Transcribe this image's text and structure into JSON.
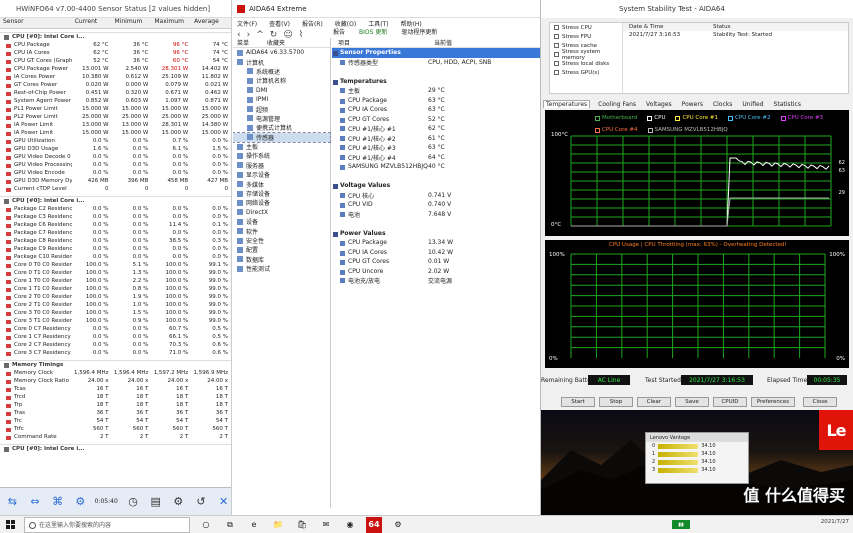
{
  "hwinfo": {
    "title": "HWiNFO64 v7.00-4400 Sensor Status [2 values hidden]",
    "headers": [
      "Sensor",
      "Current",
      "Minimum",
      "Maximum",
      "Average"
    ],
    "groups": [
      {
        "name": "CPU [#0]: Intel Core i...",
        "rows": [
          [
            "CPU Package",
            "62 °C",
            "36 °C",
            "96 °C",
            "74 °C"
          ],
          [
            "CPU IA Cores",
            "62 °C",
            "36 °C",
            "96 °C",
            "74 °C"
          ],
          [
            "CPU GT Cores (Graphics)",
            "52 °C",
            "36 °C",
            "60 °C",
            "54 °C"
          ],
          [
            "CPU Package Power",
            "13.001 W",
            "2.540 W",
            "28.301 W",
            "14.402 W"
          ],
          [
            "IA Cores Power",
            "10.380 W",
            "0.612 W",
            "25.109 W",
            "11.802 W"
          ],
          [
            "GT Cores Power",
            "0.020 W",
            "0.000 W",
            "0.079 W",
            "0.021 W"
          ],
          [
            "Rest-of-Chip Power",
            "0.451 W",
            "0.320 W",
            "0.671 W",
            "0.462 W"
          ],
          [
            "System Agent Power",
            "0.852 W",
            "0.603 W",
            "1.097 W",
            "0.871 W"
          ],
          [
            "PL1 Power Limit",
            "15.000 W",
            "15.000 W",
            "15.000 W",
            "15.000 W"
          ],
          [
            "PL2 Power Limit",
            "25.000 W",
            "25.000 W",
            "25.000 W",
            "25.000 W"
          ],
          [
            "IA Power Limit",
            "13.000 W",
            "13.000 W",
            "28.301 W",
            "14.380 W"
          ],
          [
            "IA Power Limit",
            "15.000 W",
            "15.000 W",
            "15.000 W",
            "15.000 W"
          ],
          [
            "GPU Utilization",
            "0.0 %",
            "0.0 %",
            "0.7 %",
            "0.0 %"
          ],
          [
            "GPU D3D Usage",
            "1.6 %",
            "0.0 %",
            "6.1 %",
            "1.5 %"
          ],
          [
            "GPU Video Decode 0",
            "0.0 %",
            "0.0 %",
            "0.0 %",
            "0.0 %"
          ],
          [
            "GPU Video Processing",
            "0.0 %",
            "0.0 %",
            "0.0 %",
            "0.0 %"
          ],
          [
            "GPU Video Encode",
            "0.0 %",
            "0.0 %",
            "0.0 %",
            "0.0 %"
          ],
          [
            "GPU D3D Memory Dynamic",
            "426 MB",
            "396 MB",
            "458 MB",
            "427 MB"
          ],
          [
            "Current cTDP Level",
            "0",
            "0",
            "0",
            "0"
          ]
        ]
      },
      {
        "name": "CPU [#0]: Intel Core i...",
        "rows": [
          [
            "Package C2 Residency",
            "0.0 %",
            "0.0 %",
            "0.0 %",
            "0.0 %"
          ],
          [
            "Package C3 Residency",
            "0.0 %",
            "0.0 %",
            "0.0 %",
            "0.0 %"
          ],
          [
            "Package C6 Residency",
            "0.0 %",
            "0.0 %",
            "11.4 %",
            "0.1 %"
          ],
          [
            "Package C7 Residency",
            "0.0 %",
            "0.0 %",
            "0.0 %",
            "0.0 %"
          ],
          [
            "Package C8 Residency",
            "0.0 %",
            "0.0 %",
            "38.5 %",
            "0.3 %"
          ],
          [
            "Package C9 Residency",
            "0.0 %",
            "0.0 %",
            "0.0 %",
            "0.0 %"
          ],
          [
            "Package C10 Residency",
            "0.0 %",
            "0.0 %",
            "0.0 %",
            "0.0 %"
          ],
          [
            "Core 0 T0 C0 Residency",
            "100.0 %",
            "5.1 %",
            "100.0 %",
            "99.1 %"
          ],
          [
            "Core 0 T1 C0 Residency",
            "100.0 %",
            "1.3 %",
            "100.0 %",
            "99.0 %"
          ],
          [
            "Core 1 T0 C0 Residency",
            "100.0 %",
            "2.2 %",
            "100.0 %",
            "99.0 %"
          ],
          [
            "Core 1 T1 C0 Residency",
            "100.0 %",
            "0.8 %",
            "100.0 %",
            "99.0 %"
          ],
          [
            "Core 2 T0 C0 Residency",
            "100.0 %",
            "1.9 %",
            "100.0 %",
            "99.0 %"
          ],
          [
            "Core 2 T1 C0 Residency",
            "100.0 %",
            "1.0 %",
            "100.0 %",
            "99.0 %"
          ],
          [
            "Core 3 T0 C0 Residency",
            "100.0 %",
            "1.5 %",
            "100.0 %",
            "99.0 %"
          ],
          [
            "Core 3 T1 C0 Residency",
            "100.0 %",
            "0.9 %",
            "100.0 %",
            "99.0 %"
          ],
          [
            "Core 0 C7 Residency",
            "0.0 %",
            "0.0 %",
            "60.7 %",
            "0.5 %"
          ],
          [
            "Core 1 C7 Residency",
            "0.0 %",
            "0.0 %",
            "66.1 %",
            "0.5 %"
          ],
          [
            "Core 2 C7 Residency",
            "0.0 %",
            "0.0 %",
            "70.3 %",
            "0.6 %"
          ],
          [
            "Core 3 C7 Residency",
            "0.0 %",
            "0.0 %",
            "71.0 %",
            "0.6 %"
          ]
        ]
      },
      {
        "name": "Memory Timings",
        "rows": [
          [
            "Memory Clock",
            "1,596.4 MHz",
            "1,596.4 MHz",
            "1,597.2 MHz",
            "1,596.9 MHz"
          ],
          [
            "Memory Clock Ratio",
            "24.00 x",
            "24.00 x",
            "24.00 x",
            "24.00 x"
          ],
          [
            "Tcas",
            "16 T",
            "16 T",
            "16 T",
            "16 T"
          ],
          [
            "Trcd",
            "18 T",
            "18 T",
            "18 T",
            "18 T"
          ],
          [
            "Trp",
            "18 T",
            "18 T",
            "18 T",
            "18 T"
          ],
          [
            "Tras",
            "36 T",
            "36 T",
            "36 T",
            "36 T"
          ],
          [
            "Trc",
            "54 T",
            "54 T",
            "54 T",
            "54 T"
          ],
          [
            "Trfc",
            "560 T",
            "560 T",
            "560 T",
            "560 T"
          ],
          [
            "Command Rate",
            "2 T",
            "2 T",
            "2 T",
            "2 T"
          ]
        ]
      },
      {
        "name": "CPU [#0]: Intel Core i...",
        "rows": []
      }
    ],
    "toolbar_time": "0:05:40"
  },
  "aida": {
    "title": "AIDA64 Extreme",
    "menu": [
      "文件(F)",
      "查看(V)",
      "报告(R)",
      "收藏(O)",
      "工具(T)",
      "帮助(H)"
    ],
    "toolbar": [
      "报告",
      "BIOS 更新",
      "驱动程序更新"
    ],
    "tree_headers": [
      "菜单",
      "收藏夹"
    ],
    "tree": [
      {
        "label": "AIDA64 v6.33.5700",
        "lvl": 0,
        "sel": false
      },
      {
        "label": "计算机",
        "lvl": 0,
        "sel": false
      },
      {
        "label": "系统概述",
        "lvl": 1,
        "sel": false
      },
      {
        "label": "计算机名称",
        "lvl": 1,
        "sel": false
      },
      {
        "label": "DMI",
        "lvl": 1,
        "sel": false
      },
      {
        "label": "IPMI",
        "lvl": 1,
        "sel": false
      },
      {
        "label": "超频",
        "lvl": 1,
        "sel": false
      },
      {
        "label": "电源管理",
        "lvl": 1,
        "sel": false
      },
      {
        "label": "便携式计算机",
        "lvl": 1,
        "sel": false
      },
      {
        "label": "传感器",
        "lvl": 1,
        "sel": true
      },
      {
        "label": "主板",
        "lvl": 0,
        "sel": false
      },
      {
        "label": "操作系统",
        "lvl": 0,
        "sel": false
      },
      {
        "label": "服务器",
        "lvl": 0,
        "sel": false
      },
      {
        "label": "显示设备",
        "lvl": 0,
        "sel": false
      },
      {
        "label": "多媒体",
        "lvl": 0,
        "sel": false
      },
      {
        "label": "存储设备",
        "lvl": 0,
        "sel": false
      },
      {
        "label": "网络设备",
        "lvl": 0,
        "sel": false
      },
      {
        "label": "DirectX",
        "lvl": 0,
        "sel": false
      },
      {
        "label": "设备",
        "lvl": 0,
        "sel": false
      },
      {
        "label": "软件",
        "lvl": 0,
        "sel": false
      },
      {
        "label": "安全性",
        "lvl": 0,
        "sel": false
      },
      {
        "label": "配置",
        "lvl": 0,
        "sel": false
      },
      {
        "label": "数据库",
        "lvl": 0,
        "sel": false
      },
      {
        "label": "性能测试",
        "lvl": 0,
        "sel": false
      }
    ],
    "detail_headers": [
      "项目",
      "当前值"
    ],
    "detail": [
      {
        "k": "Sensor Properties",
        "v": "",
        "sec": true,
        "sel": true
      },
      {
        "k": "传感器类型",
        "v": "CPU, HDD, ACPI, SNB",
        "sec": false,
        "sel": false
      },
      {
        "k": "",
        "v": "",
        "sec": false,
        "sel": false
      },
      {
        "k": "Temperatures",
        "v": "",
        "sec": true,
        "sel": false
      },
      {
        "k": "主板",
        "v": "29 °C",
        "sec": false,
        "sel": false
      },
      {
        "k": "CPU Package",
        "v": "63 °C",
        "sec": false,
        "sel": false
      },
      {
        "k": "CPU IA Cores",
        "v": "63 °C",
        "sec": false,
        "sel": false
      },
      {
        "k": "CPU GT Cores",
        "v": "52 °C",
        "sec": false,
        "sel": false
      },
      {
        "k": "CPU #1/核心 #1",
        "v": "62 °C",
        "sec": false,
        "sel": false
      },
      {
        "k": "CPU #1/核心 #2",
        "v": "61 °C",
        "sec": false,
        "sel": false
      },
      {
        "k": "CPU #1/核心 #3",
        "v": "63 °C",
        "sec": false,
        "sel": false
      },
      {
        "k": "CPU #1/核心 #4",
        "v": "64 °C",
        "sec": false,
        "sel": false
      },
      {
        "k": "SAMSUNG MZVLB512HBJQ",
        "v": "40 °C",
        "sec": false,
        "sel": false
      },
      {
        "k": "",
        "v": "",
        "sec": false,
        "sel": false
      },
      {
        "k": "Voltage Values",
        "v": "",
        "sec": true,
        "sel": false
      },
      {
        "k": "CPU 核心",
        "v": "0.741 V",
        "sec": false,
        "sel": false
      },
      {
        "k": "CPU VID",
        "v": "0.740 V",
        "sec": false,
        "sel": false
      },
      {
        "k": "电池",
        "v": "7.648 V",
        "sec": false,
        "sel": false
      },
      {
        "k": "",
        "v": "",
        "sec": false,
        "sel": false
      },
      {
        "k": "Power Values",
        "v": "",
        "sec": true,
        "sel": false
      },
      {
        "k": "CPU Package",
        "v": "13.34 W",
        "sec": false,
        "sel": false
      },
      {
        "k": "CPU IA Cores",
        "v": "10.42 W",
        "sec": false,
        "sel": false
      },
      {
        "k": "CPU GT Cores",
        "v": "0.01 W",
        "sec": false,
        "sel": false
      },
      {
        "k": "CPU Uncore",
        "v": "2.02 W",
        "sec": false,
        "sel": false
      },
      {
        "k": "电池充/放电",
        "v": "交流电源",
        "sec": false,
        "sel": false
      }
    ]
  },
  "stability": {
    "title": "System Stability Test - AIDA64",
    "checks": [
      "Stress CPU",
      "Stress FPU",
      "Stress cache",
      "Stress system memory",
      "Stress local disks",
      "Stress GPU(s)"
    ],
    "info_headers": [
      "Date & Time",
      "Status"
    ],
    "info_values": [
      "2021/7/27 3:16:53",
      "Stability Test: Started"
    ],
    "tabs": [
      "Temperatures",
      "Cooling Fans",
      "Voltages",
      "Powers",
      "Clocks",
      "Unified",
      "Statistics"
    ],
    "legend": [
      "Motherboard",
      "CPU",
      "CPU Core #1",
      "CPU Core #2",
      "CPU Core #3",
      "CPU Core #4",
      "SAMSUNG MZVLB512HBJQ"
    ],
    "temp_top": "100°C",
    "temp_bottom": "0°C",
    "temp_right_values": [
      "62",
      "63",
      "29"
    ],
    "usage_title": "CPU Usage | CPU Throttling (max: 63%) - Overheating Detected!",
    "usage_top_left": "100%",
    "usage_top_right": "100%",
    "usage_bottom_left": "0%",
    "usage_bottom_right": "0%",
    "remaining_label": "Remaining Battery:",
    "remaining_value": "AC Line",
    "test_started_label": "Test Started:",
    "test_started_value": "2021/7/27 3:16:53",
    "elapsed_label": "Elapsed Time:",
    "elapsed_value": "00:05:35",
    "buttons": [
      "Start",
      "Stop",
      "Clear",
      "Save",
      "CPUID",
      "Preferences",
      "Close"
    ]
  },
  "wallpaper": {
    "brand": "Le",
    "mini_title": "Lenovo Vantage",
    "mini_rows": [
      [
        "0",
        "34.10"
      ],
      [
        "1",
        "34.10"
      ],
      [
        "2",
        "34.10"
      ],
      [
        "3",
        "34.10"
      ]
    ],
    "watermark": "值 什么值得买"
  },
  "taskbar": {
    "search_placeholder": "在这里输入你要搜索的内容",
    "clock": "2021/7/27",
    "apps": [
      "○",
      "⧉",
      "e",
      "📁",
      "🛍",
      "✉",
      "◉",
      "64",
      "⚙"
    ]
  }
}
